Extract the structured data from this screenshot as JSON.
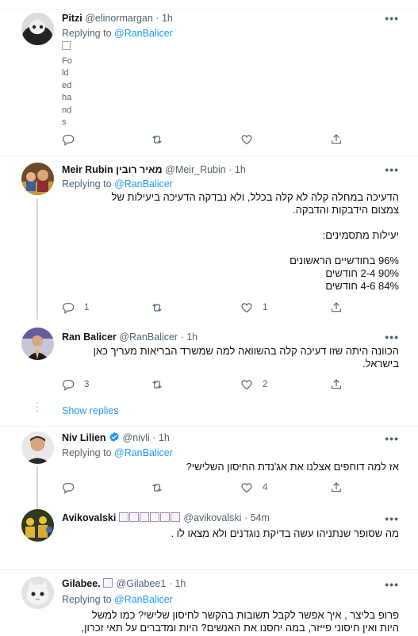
{
  "tweets": [
    {
      "name": "Pitzi",
      "handle": "@elinormargan",
      "time": "1h",
      "replying_prefix": "Replying to ",
      "replying_to": "@RanBalicer",
      "broken_image_alt": "Folded hands",
      "actions": {
        "reply": "",
        "retweet": "",
        "like": ""
      }
    },
    {
      "name": "Meir Rubin מאיר רובין",
      "handle": "@Meir_Rubin",
      "time": "1h",
      "replying_prefix": "Replying to ",
      "replying_to": "@RanBalicer",
      "body_lines": [
        "הדעיכה במחלה קלה לא קלה בכלל, ולא נבדקה הדעיכה ביעילות של",
        "צמצום הידבקות והדבקה.",
        "",
        "יעילות מתסמינים:",
        "",
        "96% בחודשיים הראשונים",
        "90% 2-4 חודשים",
        "84% 4-6 חודשים"
      ],
      "actions": {
        "reply": "1",
        "retweet": "",
        "like": "1"
      }
    },
    {
      "name": "Ran Balicer",
      "handle": "@RanBalicer",
      "time": "1h",
      "body_lines": [
        "הכוונה היתה שזו דעיכה קלה בהשוואה למה שמשרד הבריאות מעריך כאן",
        "בישראל."
      ],
      "actions": {
        "reply": "3",
        "retweet": "",
        "like": "2"
      },
      "show_replies": "Show replies"
    },
    {
      "name": "Niv Lilien",
      "handle": "@nivli",
      "time": "1h",
      "replying_prefix": "Replying to ",
      "replying_to": "@RanBalicer",
      "body_lines": [
        "אז למה דוחפים אצלנו את אג'נדת החיסון השלישי?"
      ],
      "actions": {
        "reply": "",
        "retweet": "",
        "like": "4"
      }
    },
    {
      "name": "Avikovalski",
      "handle": "@avikovalski",
      "time": "54m",
      "body_lines": [
        "מה שסופר שנתניהו עשה בדיקת נוגדנים ולא מצאו לו ."
      ],
      "actions": {
        "reply": "",
        "retweet": "",
        "like": ""
      }
    },
    {
      "name": "Gilabee.",
      "handle": "@Gilabee1",
      "time": "1h",
      "replying_prefix": "Replying to ",
      "replying_to": "@RanBalicer",
      "body_lines": [
        "פרופ בליצר , איך אפשר  לקבל תשובות בהקשר לחיסון שלישי? כמו למשל",
        "היות ואין חיסוני פייזר, במה יחסנו את האנשים? היות ומדברים על תאי זכרון,"
      ]
    }
  ],
  "more_label": "•••",
  "colors": {
    "accent": "#1d9bf0",
    "secondary_text": "#536471",
    "divider": "#eff3f4"
  }
}
